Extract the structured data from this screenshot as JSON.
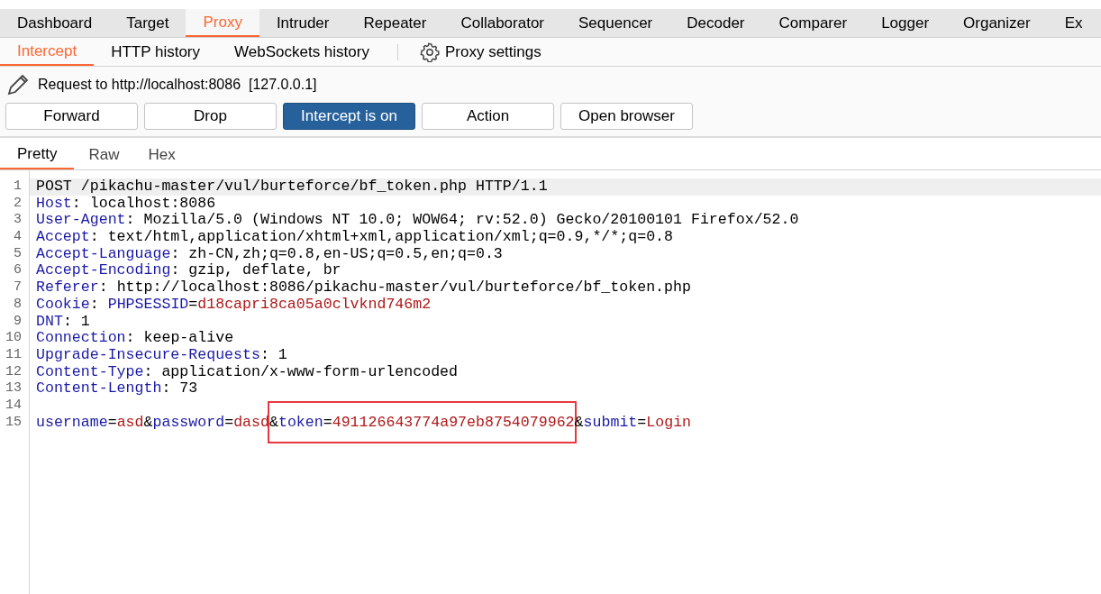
{
  "main_tabs": [
    {
      "label": "Dashboard",
      "selected": false
    },
    {
      "label": "Target",
      "selected": false
    },
    {
      "label": "Proxy",
      "selected": true
    },
    {
      "label": "Intruder",
      "selected": false
    },
    {
      "label": "Repeater",
      "selected": false
    },
    {
      "label": "Collaborator",
      "selected": false
    },
    {
      "label": "Sequencer",
      "selected": false
    },
    {
      "label": "Decoder",
      "selected": false
    },
    {
      "label": "Comparer",
      "selected": false
    },
    {
      "label": "Logger",
      "selected": false
    },
    {
      "label": "Organizer",
      "selected": false
    },
    {
      "label": "Ex",
      "selected": false
    }
  ],
  "sub_tabs": [
    {
      "label": "Intercept",
      "selected": true
    },
    {
      "label": "HTTP history",
      "selected": false
    },
    {
      "label": "WebSockets history",
      "selected": false
    }
  ],
  "settings_label": "Proxy settings",
  "request_title": "Request to http://localhost:8086",
  "request_ip": "[127.0.0.1]",
  "buttons": [
    {
      "label": "Forward",
      "on": false
    },
    {
      "label": "Drop",
      "on": false
    },
    {
      "label": "Intercept is on",
      "on": true
    },
    {
      "label": "Action",
      "on": false
    },
    {
      "label": "Open browser",
      "on": false
    }
  ],
  "view_tabs": [
    {
      "label": "Pretty",
      "selected": true
    },
    {
      "label": "Raw",
      "selected": false
    },
    {
      "label": "Hex",
      "selected": false
    }
  ],
  "lines": [
    {
      "number": "1",
      "selected": true,
      "tokens": [
        {
          "kind": "plain",
          "text": "POST /pikachu-master/vul/burteforce/bf_token.php HTTP/1.1"
        }
      ]
    },
    {
      "number": "2",
      "selected": false,
      "tokens": [
        {
          "kind": "name",
          "text": "Host"
        },
        {
          "kind": "plain",
          "text": ": localhost:8086"
        }
      ]
    },
    {
      "number": "3",
      "selected": false,
      "tokens": [
        {
          "kind": "name",
          "text": "User-Agent"
        },
        {
          "kind": "plain",
          "text": ": Mozilla/5.0 (Windows NT 10.0; WOW64; rv:52.0) Gecko/20100101 Firefox/52.0"
        }
      ]
    },
    {
      "number": "4",
      "selected": false,
      "tokens": [
        {
          "kind": "name",
          "text": "Accept"
        },
        {
          "kind": "plain",
          "text": ": text/html,application/xhtml+xml,application/xml;q=0.9,*/*;q=0.8"
        }
      ]
    },
    {
      "number": "5",
      "selected": false,
      "tokens": [
        {
          "kind": "name",
          "text": "Accept-Language"
        },
        {
          "kind": "plain",
          "text": ": zh-CN,zh;q=0.8,en-US;q=0.5,en;q=0.3"
        }
      ]
    },
    {
      "number": "6",
      "selected": false,
      "tokens": [
        {
          "kind": "name",
          "text": "Accept-Encoding"
        },
        {
          "kind": "plain",
          "text": ": gzip, deflate, br"
        }
      ]
    },
    {
      "number": "7",
      "selected": false,
      "tokens": [
        {
          "kind": "name",
          "text": "Referer"
        },
        {
          "kind": "plain",
          "text": ": http://localhost:8086/pikachu-master/vul/burteforce/bf_token.php"
        }
      ]
    },
    {
      "number": "8",
      "selected": false,
      "tokens": [
        {
          "kind": "name",
          "text": "Cookie"
        },
        {
          "kind": "plain",
          "text": ": "
        },
        {
          "kind": "param",
          "text": "PHPSESSID"
        },
        {
          "kind": "plain",
          "text": "="
        },
        {
          "kind": "value",
          "text": "d18capri8ca05a0clvknd746m2"
        }
      ]
    },
    {
      "number": "9",
      "selected": false,
      "tokens": [
        {
          "kind": "name",
          "text": "DNT"
        },
        {
          "kind": "plain",
          "text": ": 1"
        }
      ]
    },
    {
      "number": "10",
      "selected": false,
      "tokens": [
        {
          "kind": "name",
          "text": "Connection"
        },
        {
          "kind": "plain",
          "text": ": keep-alive"
        }
      ]
    },
    {
      "number": "11",
      "selected": false,
      "tokens": [
        {
          "kind": "name",
          "text": "Upgrade-Insecure-Requests"
        },
        {
          "kind": "plain",
          "text": ": 1"
        }
      ]
    },
    {
      "number": "12",
      "selected": false,
      "tokens": [
        {
          "kind": "name",
          "text": "Content-Type"
        },
        {
          "kind": "plain",
          "text": ": application/x-www-form-urlencoded"
        }
      ]
    },
    {
      "number": "13",
      "selected": false,
      "tokens": [
        {
          "kind": "name",
          "text": "Content-Length"
        },
        {
          "kind": "plain",
          "text": ": 73"
        }
      ]
    },
    {
      "number": "14",
      "selected": false
    },
    {
      "number": "15",
      "selected": false,
      "segments": [
        {
          "highlighted": false,
          "tokens": [
            {
              "kind": "param",
              "text": "username"
            },
            {
              "kind": "plain",
              "text": "="
            },
            {
              "kind": "value",
              "text": "asd"
            },
            {
              "kind": "plain",
              "text": "&"
            },
            {
              "kind": "param",
              "text": "password"
            },
            {
              "kind": "plain",
              "text": "="
            },
            {
              "kind": "value",
              "text": "dasd"
            }
          ]
        },
        {
          "highlighted": true,
          "tokens": [
            {
              "kind": "plain",
              "text": "&"
            },
            {
              "kind": "param",
              "text": "token"
            },
            {
              "kind": "plain",
              "text": "="
            },
            {
              "kind": "value",
              "text": "491126643774a97eb8754079962"
            }
          ]
        },
        {
          "highlighted": false,
          "tokens": [
            {
              "kind": "plain",
              "text": "&"
            },
            {
              "kind": "param",
              "text": "submit"
            },
            {
              "kind": "plain",
              "text": "="
            },
            {
              "kind": "value",
              "text": "Login"
            }
          ]
        }
      ]
    }
  ]
}
